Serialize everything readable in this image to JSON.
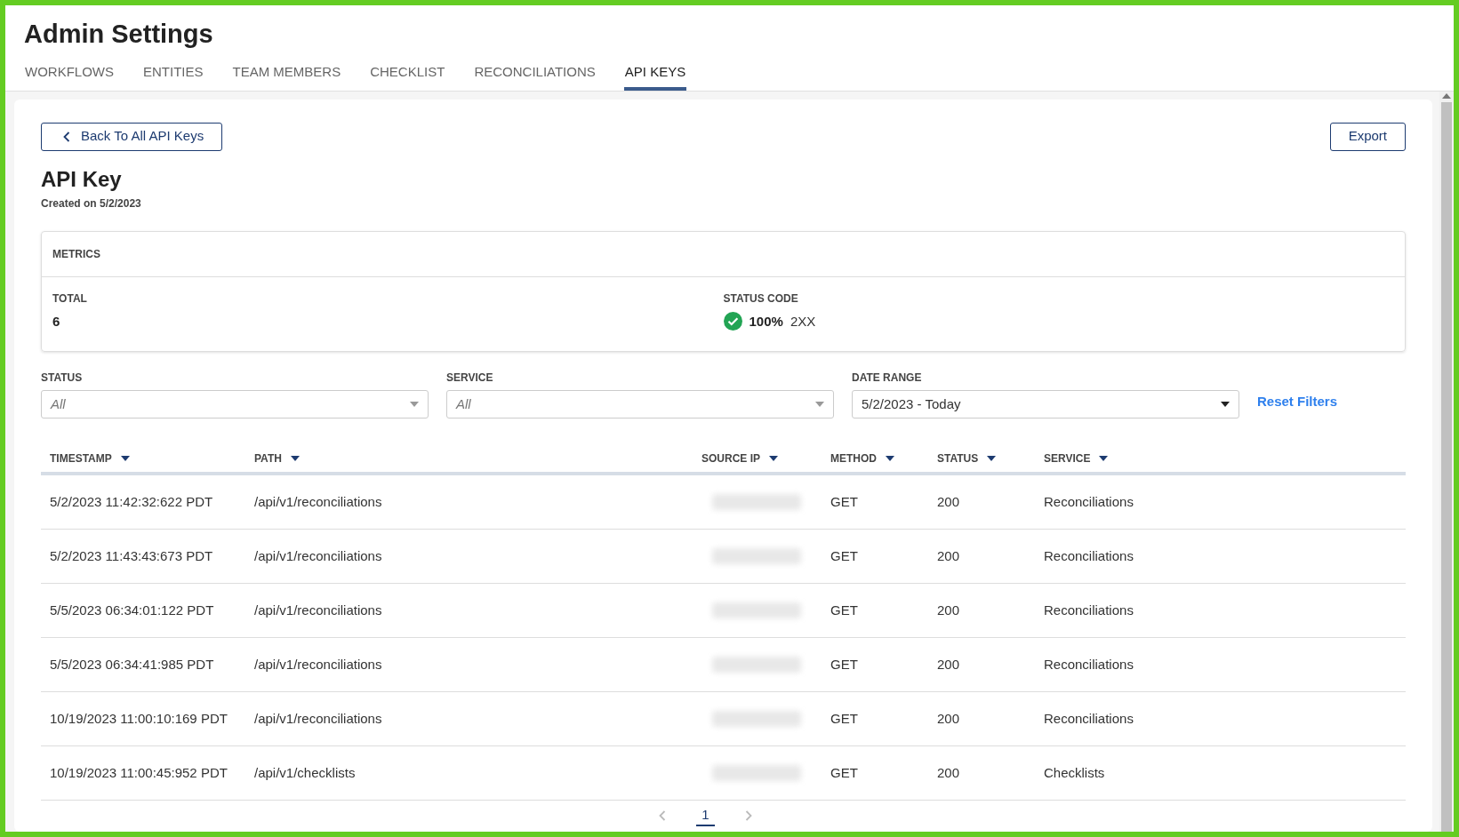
{
  "page": {
    "title": "Admin Settings"
  },
  "tabs": [
    {
      "label": "WORKFLOWS",
      "selected": false
    },
    {
      "label": "ENTITIES",
      "selected": false
    },
    {
      "label": "TEAM MEMBERS",
      "selected": false
    },
    {
      "label": "CHECKLIST",
      "selected": false
    },
    {
      "label": "RECONCILIATIONS",
      "selected": false
    },
    {
      "label": "API KEYS",
      "selected": true
    }
  ],
  "back_button": "Back To All API Keys",
  "export_button": "Export",
  "key": {
    "title": "API Key",
    "created": "Created on 5/2/2023"
  },
  "metrics": {
    "heading": "METRICS",
    "total_label": "TOTAL",
    "total": "6",
    "status_label": "STATUS CODE",
    "status_percent": "100%",
    "status_class": "2XX"
  },
  "filters": [
    {
      "label": "STATUS",
      "value": "All",
      "kind": "placeholder"
    },
    {
      "label": "SERVICE",
      "value": "All",
      "kind": "placeholder"
    },
    {
      "label": "DATE RANGE",
      "value": "5/2/2023 - Today",
      "kind": "value"
    }
  ],
  "reset_filters": "Reset Filters",
  "table": {
    "columns": [
      "TIMESTAMP",
      "PATH",
      "SOURCE IP",
      "METHOD",
      "STATUS",
      "SERVICE"
    ],
    "rows": [
      {
        "timestamp": "5/2/2023 11:42:32:622 PDT",
        "path": "/api/v1/reconciliations",
        "method": "GET",
        "status": "200",
        "service": "Reconciliations"
      },
      {
        "timestamp": "5/2/2023 11:43:43:673 PDT",
        "path": "/api/v1/reconciliations",
        "method": "GET",
        "status": "200",
        "service": "Reconciliations"
      },
      {
        "timestamp": "5/5/2023 06:34:01:122 PDT",
        "path": "/api/v1/reconciliations",
        "method": "GET",
        "status": "200",
        "service": "Reconciliations"
      },
      {
        "timestamp": "5/5/2023 06:34:41:985 PDT",
        "path": "/api/v1/reconciliations",
        "method": "GET",
        "status": "200",
        "service": "Reconciliations"
      },
      {
        "timestamp": "10/19/2023 11:00:10:169 PDT",
        "path": "/api/v1/reconciliations",
        "method": "GET",
        "status": "200",
        "service": "Reconciliations"
      },
      {
        "timestamp": "10/19/2023 11:00:45:952 PDT",
        "path": "/api/v1/checklists",
        "method": "GET",
        "status": "200",
        "service": "Checklists"
      }
    ]
  },
  "pagination": {
    "pages": [
      {
        "label": "1",
        "selected": true
      }
    ]
  }
}
